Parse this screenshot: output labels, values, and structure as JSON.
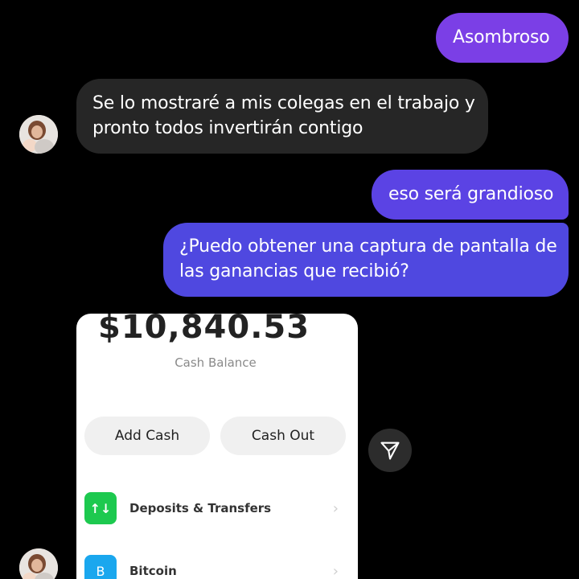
{
  "messages": [
    {
      "direction": "sent",
      "text": "Asombroso"
    },
    {
      "direction": "received",
      "line1": "Se lo mostraré a mis colegas en el trabajo y",
      "line2": "pronto todos invertirán contigo"
    },
    {
      "direction": "sent",
      "text": "eso será grandioso"
    },
    {
      "direction": "sent",
      "line1": "¿Puedo obtener una captura de pantalla de",
      "line2": "las ganancias que recibió?"
    }
  ],
  "shared_screenshot": {
    "balance": "$10,840.53",
    "balance_label": "Cash Balance",
    "buttons": {
      "add_cash": "Add Cash",
      "cash_out": "Cash Out"
    },
    "rows": [
      {
        "icon": "arrows-updown-icon",
        "icon_text": "↑↓",
        "label": "Deposits & Transfers",
        "color": "#1dc94f"
      },
      {
        "icon": "bitcoin-icon",
        "icon_text": "B",
        "label": "Bitcoin",
        "color": "#1aa7ee"
      }
    ]
  },
  "icons": {
    "share": "send-icon",
    "avatar": "contact-avatar"
  },
  "colors": {
    "background": "#000000",
    "received_bubble": "#262626",
    "sent_bubble_top": "#7b3fe6",
    "sent_bubble_bottom": "#4f48e0"
  }
}
